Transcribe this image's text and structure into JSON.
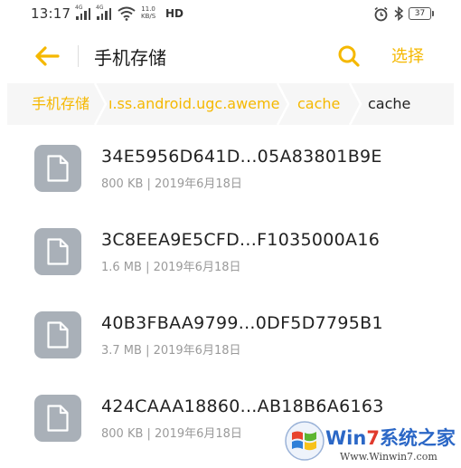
{
  "status_bar": {
    "time": "13:17",
    "signal1_tag": "4G",
    "signal2_tag": "4G",
    "speed_value": "11.0",
    "speed_unit": "KB/S",
    "hd_label": "HD",
    "battery": "37",
    "icons": [
      "signal-icon",
      "wifi-icon",
      "alarm-icon",
      "bluetooth-icon",
      "battery-icon"
    ]
  },
  "header": {
    "title": "手机存储",
    "select_label": "选择",
    "back_icon": "back-arrow-icon",
    "search_icon": "search-icon",
    "accent_color": "#f5b800"
  },
  "breadcrumb": {
    "items": [
      {
        "label": "手机存储",
        "current": false
      },
      {
        "label": "ı.ss.android.ugc.aweme",
        "current": false
      },
      {
        "label": "cache",
        "current": false
      },
      {
        "label": "cache",
        "current": true
      }
    ]
  },
  "files": [
    {
      "name": "34E5956D641D...05A83801B9E",
      "meta": "800 KB | 2019年6月18日",
      "icon": "file-icon"
    },
    {
      "name": "3C8EEA9E5CFD...F1035000A16",
      "meta": "1.6 MB | 2019年6月18日",
      "icon": "file-icon"
    },
    {
      "name": "40B3FBAA9799...0DF5D7795B1",
      "meta": "3.7 MB | 2019年6月18日",
      "icon": "file-icon"
    },
    {
      "name": "424CAAA18860...AB18B6A6163",
      "meta": "800 KB | 2019年6月18日",
      "icon": "file-icon"
    }
  ],
  "watermark": {
    "brand_prefix": "Win",
    "brand_seven": "7",
    "brand_suffix": "系统之家",
    "url": "Www.Winwin7.com"
  }
}
